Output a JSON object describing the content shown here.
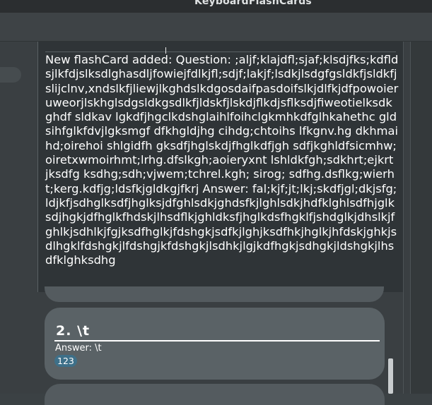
{
  "window": {
    "title": "KeyboardFlashCards"
  },
  "result": {
    "text": "New flashCard added: Question: ;aljf;klajdfl;sjaf;klsdjfks;kdfldsjlkfdjslksdlghasdljfowiejfdlkjfl;sdjf;lakjf;lsdkjlsdgfgsldkfjsldkfjslijclnv,xndslkfjliewjlkghdslkdgosdaifpasdoifslkjdlfkjdfpowoieruweorjlskhglsdgsldkgsdlkfjldskfjlskdjflkdjsflksdjfiweotielksdkghdf sldkav lgkdfjhgclkdshglaihlfoihclgkmhkdfglhkahethc gldsihfglkfdvjlgksmgf dfkhgldjhg cihdg;chtoihs lfkgnv.hg dkhmaihd;oirehoi shlgidfh gksdfjhglskdjfhglkdfjgh sdfjkghldfsicmhw;oiretxwmoirhmt;lrhg.dfslkgh;aoieryxnt lshldkfgh;sdkhrt;ejkrt jksdfg ksdhg;sdh;vjwem;tchrel.kgh; sirog; sdfhg.dsflkg;wierht;kerg.kdfjg;ldsfkjgldkgjfkrj Answer: fal;kjf;jt;lkj;skdfjgl;dkjsfg;ldjkfjsdhglksdfjhglksjdfghlsdkjghdsfkjlghlsdkjhdfklghlsdfhjglksdjhgkjdfhglkfhdskjlhsdflkjghldksfjhglkdsfhgklfjshdglkjdhslkjfghlkjsdhlkjfgjksdfhglkjfdshgkjsdfkjlghjksdfhkjhglkjhfdskjghkjsdlhgklfdshgkjlfdshgjkfdshgkjlsdhkjlgjkdfhgkjsdhgkjldshgkjlhsdfklghksdhg"
  },
  "cards": [
    {
      "index_label": "2.",
      "question": "\\t",
      "answer_label": "Answer: \\t",
      "tag": "123"
    }
  ]
}
